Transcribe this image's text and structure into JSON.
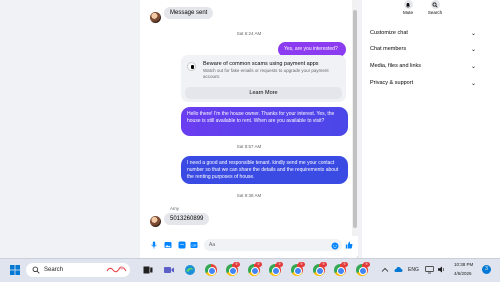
{
  "chat": {
    "top_message": "Message sent",
    "ts1": "Sat 6:24 AM",
    "out1": "Yes, are you interested?",
    "scam_card": {
      "title": "Beware of common scams using payment apps",
      "desc": "Watch out for fake emails or requests to upgrade your payment account.",
      "button": "Learn More"
    },
    "out2": "Hello there! I'm the house owner. Thanks for your interest. Yes, the house is still available to rent.  When are you available to visit?",
    "ts2": "Sat 8:57 AM",
    "out3": "I need a good and responsible tenant.  kindly send me your contact number so that we can share the details and the requirements about the renting purposes of house.",
    "ts3": "Sat 9:38 AM",
    "sender_name": "Amy",
    "in_phone": "5013260899",
    "composer_placeholder": "Aa"
  },
  "info": {
    "mute_label": "Mute",
    "search_label": "Search",
    "rows": [
      "Customize chat",
      "Chat members",
      "Media, files and links",
      "Privacy & support"
    ]
  },
  "taskbar": {
    "search_placeholder": "Search",
    "lang": "ENG",
    "time": "10:38 PM",
    "date": "4/6/2026",
    "badge_chrome_1": "9",
    "badge_chrome_2": "9",
    "badge_chrome_3": "9",
    "badge_chrome_4": "9",
    "badge_chrome_5": "9",
    "badge_chrome_6": "9",
    "badge_chrome_7": "9",
    "notification_count": "3"
  },
  "colors": {
    "messenger_purple": "#8b3bf0",
    "messenger_blue": "#3a4be3",
    "accent": "#0084ff"
  }
}
